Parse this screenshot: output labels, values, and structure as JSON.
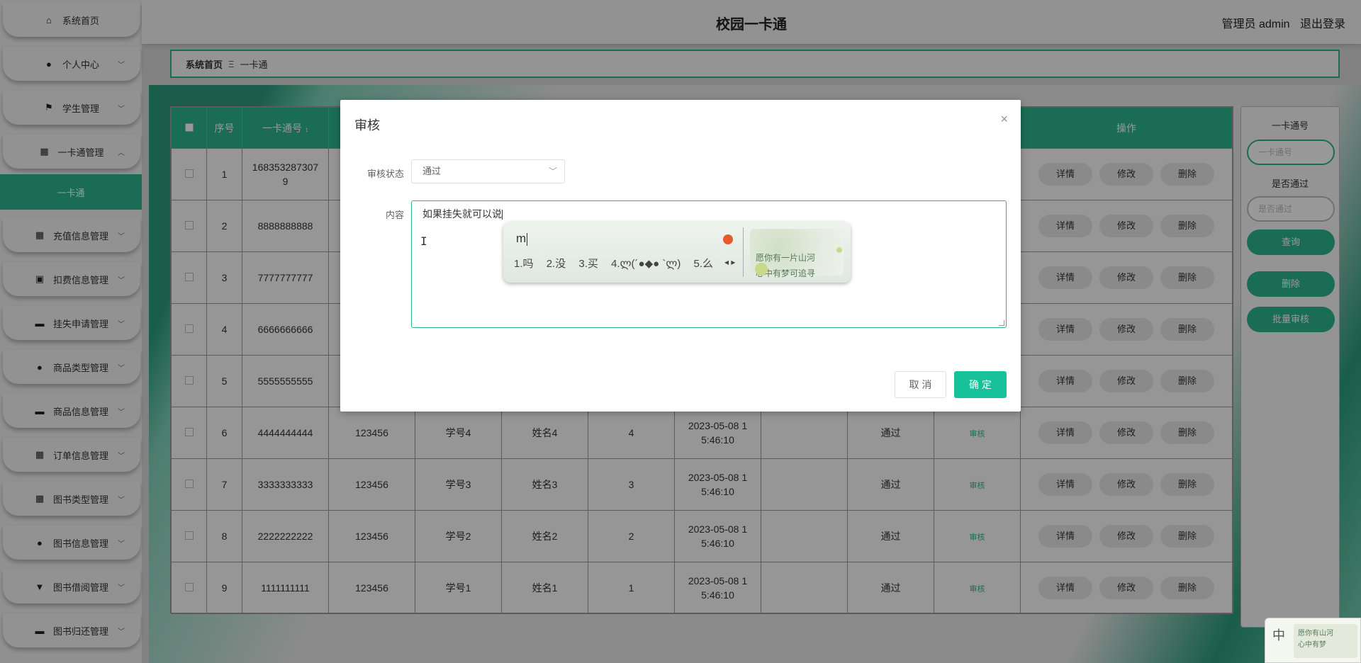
{
  "header": {
    "title": "校园一卡通",
    "user_label": "管理员 admin",
    "logout": "退出登录"
  },
  "sidebar": {
    "items": [
      {
        "label": "系统首页",
        "icon": "home-icon",
        "glyph": "⌂",
        "chevron": ""
      },
      {
        "label": "个人中心",
        "icon": "user-icon",
        "glyph": "●",
        "chevron": "﹀"
      },
      {
        "label": "学生管理",
        "icon": "flag-icon",
        "glyph": "⚑",
        "chevron": "﹀"
      },
      {
        "label": "一卡通管理",
        "icon": "grid-icon",
        "glyph": "▦",
        "chevron": "︿"
      },
      {
        "label": "充值信息管理",
        "icon": "grid-icon",
        "glyph": "▦",
        "chevron": "﹀"
      },
      {
        "label": "扣费信息管理",
        "icon": "receipt-icon",
        "glyph": "▣",
        "chevron": "﹀"
      },
      {
        "label": "挂失申请管理",
        "icon": "card-icon",
        "glyph": "▬",
        "chevron": "﹀"
      },
      {
        "label": "商品类型管理",
        "icon": "location-icon",
        "glyph": "●",
        "chevron": "﹀"
      },
      {
        "label": "商品信息管理",
        "icon": "briefcase-icon",
        "glyph": "▬",
        "chevron": "﹀"
      },
      {
        "label": "订单信息管理",
        "icon": "grid-icon",
        "glyph": "▦",
        "chevron": "﹀"
      },
      {
        "label": "图书类型管理",
        "icon": "grid-icon",
        "glyph": "▦",
        "chevron": "﹀"
      },
      {
        "label": "图书信息管理",
        "icon": "person-icon",
        "glyph": "●",
        "chevron": "﹀"
      },
      {
        "label": "图书借阅管理",
        "icon": "pin-icon",
        "glyph": "▼",
        "chevron": "﹀"
      },
      {
        "label": "图书归还管理",
        "icon": "ticket-icon",
        "glyph": "▬",
        "chevron": "﹀"
      }
    ],
    "sub_item": "一卡通"
  },
  "breadcrumb": {
    "home": "系统首页",
    "sep": "Ξ",
    "current": "一卡通"
  },
  "table": {
    "headers": [
      "序号",
      "一卡通号",
      "",
      "",
      "",
      "",
      "",
      "",
      "",
      "",
      "操作"
    ],
    "rows": [
      {
        "no": "1",
        "card": "168353287307\n9",
        "pwd": "",
        "sid": "",
        "name": "",
        "amount": "",
        "time": "",
        "blank": "",
        "status": "",
        "review": ""
      },
      {
        "no": "2",
        "card": "8888888888",
        "pwd": "",
        "sid": "",
        "name": "",
        "amount": "",
        "time": "",
        "blank": "",
        "status": "",
        "review": ""
      },
      {
        "no": "3",
        "card": "7777777777",
        "pwd": "",
        "sid": "",
        "name": "",
        "amount": "",
        "time": "",
        "blank": "",
        "status": "",
        "review": ""
      },
      {
        "no": "4",
        "card": "6666666666",
        "pwd": "",
        "sid": "",
        "name": "",
        "amount": "",
        "time": "",
        "blank": "",
        "status": "",
        "review": ""
      },
      {
        "no": "5",
        "card": "5555555555",
        "pwd": "",
        "sid": "",
        "name": "",
        "amount": "",
        "time": "",
        "blank": "",
        "status": "",
        "review": ""
      },
      {
        "no": "6",
        "card": "4444444444",
        "pwd": "123456",
        "sid": "学号4",
        "name": "姓名4",
        "amount": "4",
        "time": "2023-05-08 1\n5:46:10",
        "blank": "",
        "status": "通过",
        "review": "审核"
      },
      {
        "no": "7",
        "card": "3333333333",
        "pwd": "123456",
        "sid": "学号3",
        "name": "姓名3",
        "amount": "3",
        "time": "2023-05-08 1\n5:46:10",
        "blank": "",
        "status": "通过",
        "review": "审核"
      },
      {
        "no": "8",
        "card": "2222222222",
        "pwd": "123456",
        "sid": "学号2",
        "name": "姓名2",
        "amount": "2",
        "time": "2023-05-08 1\n5:46:10",
        "blank": "",
        "status": "通过",
        "review": "审核"
      },
      {
        "no": "9",
        "card": "1111111111",
        "pwd": "123456",
        "sid": "学号1",
        "name": "姓名1",
        "amount": "1",
        "time": "2023-05-08 1\n5:46:10",
        "blank": "",
        "status": "通过",
        "review": "审核"
      }
    ],
    "actions": [
      "详情",
      "修改",
      "删除"
    ],
    "sort_glyph": "↕"
  },
  "search_panel": {
    "card_label": "一卡通号",
    "card_placeholder": "一卡通号",
    "pass_label": "是否通过",
    "pass_placeholder": "是否通过",
    "query_btn": "查询",
    "delete_btn": "删除",
    "batch_btn": "批量审核"
  },
  "modal": {
    "title": "审核",
    "close_glyph": "×",
    "status_label": "审核状态",
    "status_value": "通过",
    "content_label": "内容",
    "content_value": "如果挂失就可以说",
    "cancel_btn": "取 消",
    "confirm_btn": "确 定"
  },
  "ime": {
    "composition": "m",
    "candidates": [
      "1.吗",
      "2.没",
      "3.买",
      "4.ლ(´●◆● `ლ)",
      "5.么"
    ],
    "nav": "◂ ▸",
    "art_text": "愿你有一片山河\n心中有梦可追寻"
  },
  "tray": {
    "lang": "中",
    "art_text": "愿你有山河\n心中有梦"
  },
  "colors": {
    "accent": "#2db48c",
    "confirm": "#17c29a"
  }
}
